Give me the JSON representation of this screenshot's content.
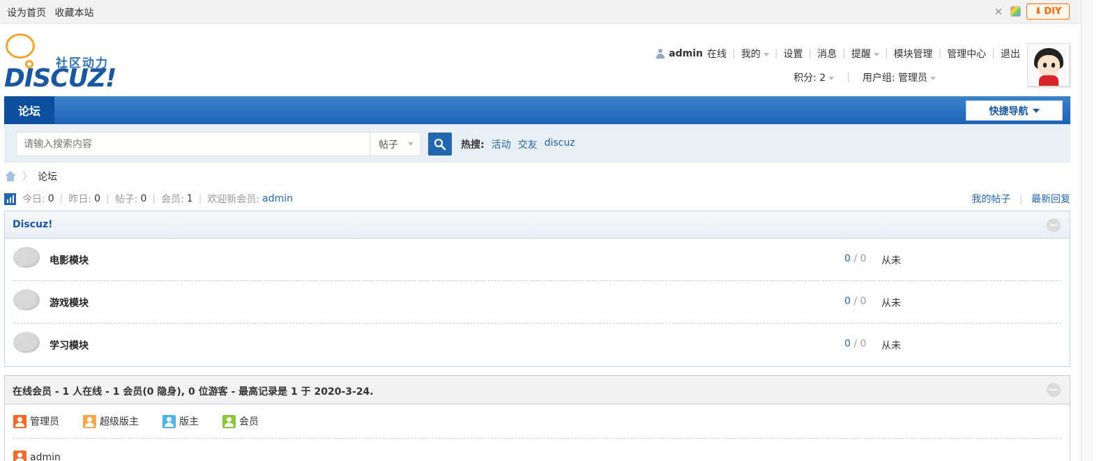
{
  "topbar": {
    "set_home": "设为首页",
    "bookmark": "收藏本站",
    "diy_label": "DIY",
    "icons": [
      "switch-width-icon",
      "color-scheme-icon"
    ]
  },
  "header": {
    "logo_slogan": "社区动力",
    "logo_brand": "DISCUZ!",
    "user": {
      "name": "admin",
      "status": "在线",
      "menu": [
        "我的",
        "设置",
        "消息",
        "提醒",
        "模块管理",
        "管理中心",
        "退出"
      ],
      "credits_label": "积分: 2",
      "group_label": "用户组: 管理员"
    }
  },
  "nav": {
    "tab_forum": "论坛",
    "quick_nav": "快捷导航"
  },
  "search": {
    "placeholder": "请输入搜索内容",
    "type": "帖子",
    "hot_label": "热搜:",
    "hot_terms": [
      "活动",
      "交友",
      "discuz"
    ]
  },
  "breadcrumb": {
    "current": "论坛"
  },
  "stats": {
    "today_label": "今日:",
    "today": "0",
    "yesterday_label": "昨日:",
    "yesterday": "0",
    "posts_label": "帖子:",
    "posts": "0",
    "members_label": "会员:",
    "members": "1",
    "welcome_label": "欢迎新会员:",
    "newest_member": "admin",
    "my_posts": "我的帖子",
    "latest_replies": "最新回复"
  },
  "category": {
    "title": "Discuz!",
    "forums": [
      {
        "name": "电影模块",
        "threads": "0",
        "posts": "0",
        "last_post": "从未"
      },
      {
        "name": "游戏模块",
        "threads": "0",
        "posts": "0",
        "last_post": "从未"
      },
      {
        "name": "学习模块",
        "threads": "0",
        "posts": "0",
        "last_post": "从未"
      }
    ]
  },
  "online": {
    "title": "在线会员 - 1 人在线 - 1 会员(0 隐身), 0 位游客 - 最高记录是 1 于 2020-3-24.",
    "legend": [
      {
        "label": "管理员",
        "color": "#f36b2b"
      },
      {
        "label": "超级版主",
        "color": "#f5a94a"
      },
      {
        "label": "版主",
        "color": "#4cb6e8"
      },
      {
        "label": "会员",
        "color": "#8cc63f"
      }
    ],
    "members": [
      "admin"
    ]
  },
  "colors": {
    "brand_blue": "#1a57a2",
    "nav_blue": "#2366b0",
    "accent_orange": "#f60"
  }
}
